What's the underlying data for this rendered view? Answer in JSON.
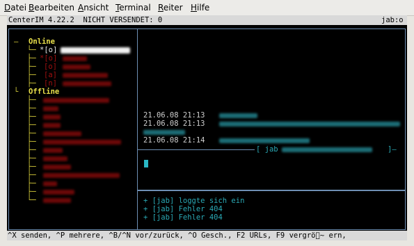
{
  "menu": {
    "items": [
      {
        "label": "Datei",
        "u": "D",
        "rest": "atei"
      },
      {
        "label": "Bearbeiten",
        "u": "B",
        "rest": "earbeiten"
      },
      {
        "label": "Ansicht",
        "u": "A",
        "rest": "nsicht"
      },
      {
        "label": "Terminal",
        "u": "T",
        "rest": "erminal"
      },
      {
        "label": "Reiter",
        "u": "R",
        "rest": "eiter"
      },
      {
        "label": "Hilfe",
        "u": "H",
        "rest": "ilfe"
      }
    ]
  },
  "status_top": {
    "left": "CenterIM 4.22.2  NICHT VERSENDET: 0",
    "right": "jab:o"
  },
  "contacts": {
    "online_header": "Online",
    "offline_header": "Offline",
    "online": [
      {
        "prefix": "*[o]",
        "selected": true
      },
      {
        "prefix": "*[o]"
      },
      {
        "prefix": "[o]"
      },
      {
        "prefix": "[a]"
      },
      {
        "prefix": "[n]"
      }
    ],
    "offline_count": 13
  },
  "chat": {
    "messages": [
      {
        "time": "21.06.08 21:13"
      },
      {
        "time": "21.06.08 21:13"
      },
      {
        "time": "21.06.08 21:14"
      }
    ],
    "separator_label": "[ jab",
    "separator_end": "]—"
  },
  "log": {
    "lines": [
      "+ [jab] loggte sich ein",
      "+ [jab] Fehler 404",
      "+ [jab] Fehler 404"
    ]
  },
  "status_bottom": {
    "text": "^X senden, ^P mehrere, ^B/^N vor/zurück, ^O Gesch., F2 URLs, F9 vergrö\u0000~ ern,"
  }
}
